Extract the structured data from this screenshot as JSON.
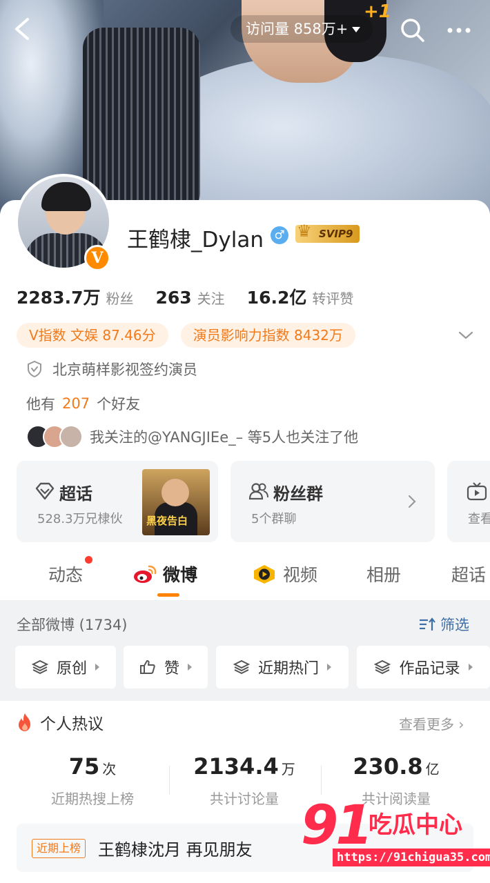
{
  "header": {
    "visits_label": "访问量 858万+",
    "plus_one": "+1"
  },
  "profile": {
    "username": "王鹤棣_Dylan",
    "gender_symbol": "♂",
    "vip_label": "SVIP9",
    "verified_badge": "V",
    "stats": [
      {
        "value": "2283.7万",
        "label": "粉丝"
      },
      {
        "value": "263",
        "label": "关注"
      },
      {
        "value": "16.2亿",
        "label": "转评赞"
      }
    ],
    "pills": [
      "V指数 文娱 87.46分",
      "演员影响力指数 8432万"
    ],
    "verification": "北京萌样影视签约演员",
    "friends_prefix": "他有",
    "friends_count": "207",
    "friends_suffix": "个好友",
    "mutual_text": "我关注的@YANGJIEe_– 等5人也关注了他"
  },
  "cards": [
    {
      "title": "超话",
      "sub": "528.3万兄棣伙",
      "poster_text": "黑夜告白"
    },
    {
      "title": "粉丝群",
      "sub": "5个群聊"
    },
    {
      "title": "",
      "sub": "查看"
    }
  ],
  "tabs": [
    {
      "label": "动态",
      "has_dot": true
    },
    {
      "label": "微博",
      "active": true
    },
    {
      "label": "视频"
    },
    {
      "label": "相册"
    },
    {
      "label": "超话"
    }
  ],
  "feed": {
    "all_label": "全部微博 (1734)",
    "filter_label": "筛选",
    "chips": [
      "原创",
      "赞",
      "近期热门",
      "作品记录"
    ]
  },
  "hot": {
    "title": "个人热议",
    "see_more": "查看更多 ›",
    "metrics": [
      {
        "value": "75",
        "unit": "次",
        "label": "近期热搜上榜"
      },
      {
        "value": "2134.4",
        "unit": "万",
        "label": "共计讨论量"
      },
      {
        "value": "230.8",
        "unit": "亿",
        "label": "共计阅读量"
      }
    ],
    "recent_tag": "近期上榜",
    "recent_text": "王鹤棣沈月 再见朋友"
  },
  "watermark": {
    "number": "91",
    "brand": "吃瓜中心",
    "url": "https://91chigua35.com"
  },
  "colors": {
    "accent": "#ff8200",
    "pill_text": "#f27a1a",
    "link_blue": "#3e6ea6",
    "watermark_red": "#ff2d4b"
  }
}
